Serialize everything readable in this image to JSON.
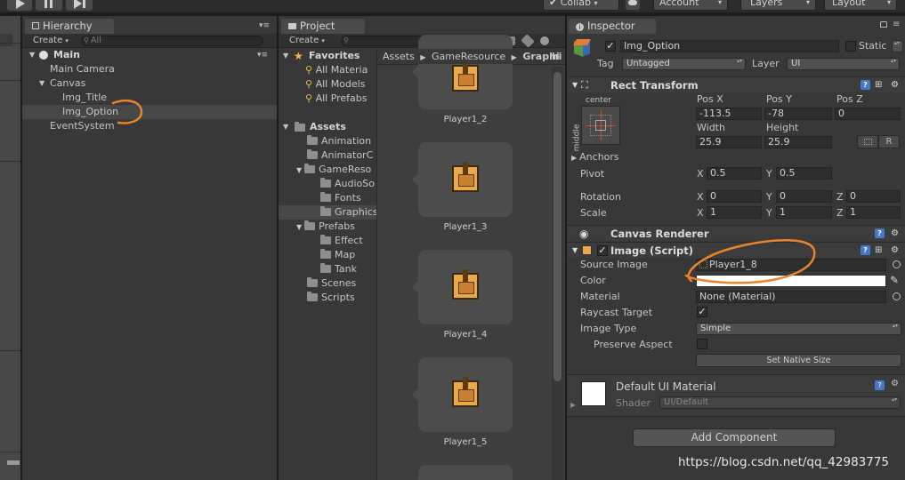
{
  "toolbar": {
    "collab": "Collab",
    "account": "Account",
    "layers": "Layers",
    "layout": "Layout"
  },
  "hierarchy": {
    "tab": "Hierarchy",
    "create": "Create",
    "search_placeholder": "All",
    "scene": "Main",
    "items": [
      "Main Camera",
      "Canvas",
      "Img_Title",
      "Img_Option",
      "EventSystem"
    ]
  },
  "project": {
    "tab": "Project",
    "create": "Create",
    "favorites": "Favorites",
    "fav_items": [
      "All Materia",
      "All Models",
      "All Prefabs"
    ],
    "assets": "Assets",
    "folders": [
      "Animation",
      "AnimatorC",
      "GameReso",
      "AudioSo",
      "Fonts",
      "Graphics",
      "Prefabs",
      "Effect",
      "Map",
      "Tank",
      "Scenes",
      "Scripts"
    ],
    "breadcrumb": [
      "Assets",
      "GameResource",
      "Graphi"
    ],
    "sprites": [
      "Player1_2",
      "Player1_3",
      "Player1_4",
      "Player1_5"
    ]
  },
  "inspector": {
    "tab": "Inspector",
    "object_name": "Img_Option",
    "static_label": "Static",
    "tag_label": "Tag",
    "tag_value": "Untagged",
    "layer_label": "Layer",
    "layer_value": "UI",
    "rect_transform": {
      "title": "Rect Transform",
      "anchor_h": "center",
      "anchor_v": "middle",
      "pos_x_label": "Pos X",
      "pos_y_label": "Pos Y",
      "pos_z_label": "Pos Z",
      "pos_x": "-113.5",
      "pos_y": "-78",
      "pos_z": "0",
      "width_label": "Width",
      "height_label": "Height",
      "width": "25.9",
      "height": "25.9",
      "r_button": "R",
      "anchors_label": "Anchors",
      "pivot_label": "Pivot",
      "pivot_x": "0.5",
      "pivot_y": "0.5",
      "rotation_label": "Rotation",
      "rot_x": "0",
      "rot_y": "0",
      "rot_z": "0",
      "scale_label": "Scale",
      "scale_x": "1",
      "scale_y": "1",
      "scale_z": "1",
      "x": "X",
      "y": "Y",
      "z": "Z"
    },
    "canvas_renderer": "Canvas Renderer",
    "image": {
      "title": "Image (Script)",
      "source_label": "Source Image",
      "source_value": "Player1_8",
      "color_label": "Color",
      "material_label": "Material",
      "material_value": "None (Material)",
      "raycast_label": "Raycast Target",
      "image_type_label": "Image Type",
      "image_type_value": "Simple",
      "preserve_label": "Preserve Aspect",
      "native_button": "Set Native Size"
    },
    "material": {
      "name": "Default UI Material",
      "shader_label": "Shader",
      "shader_value": "UI/Default"
    },
    "add_component": "Add Component"
  },
  "watermark": "https://blog.csdn.net/qq_42983775",
  "colors": {
    "accent_orange": "#e8852a",
    "sprite_orange": "#e9a94a",
    "panel_bg": "#383838"
  }
}
